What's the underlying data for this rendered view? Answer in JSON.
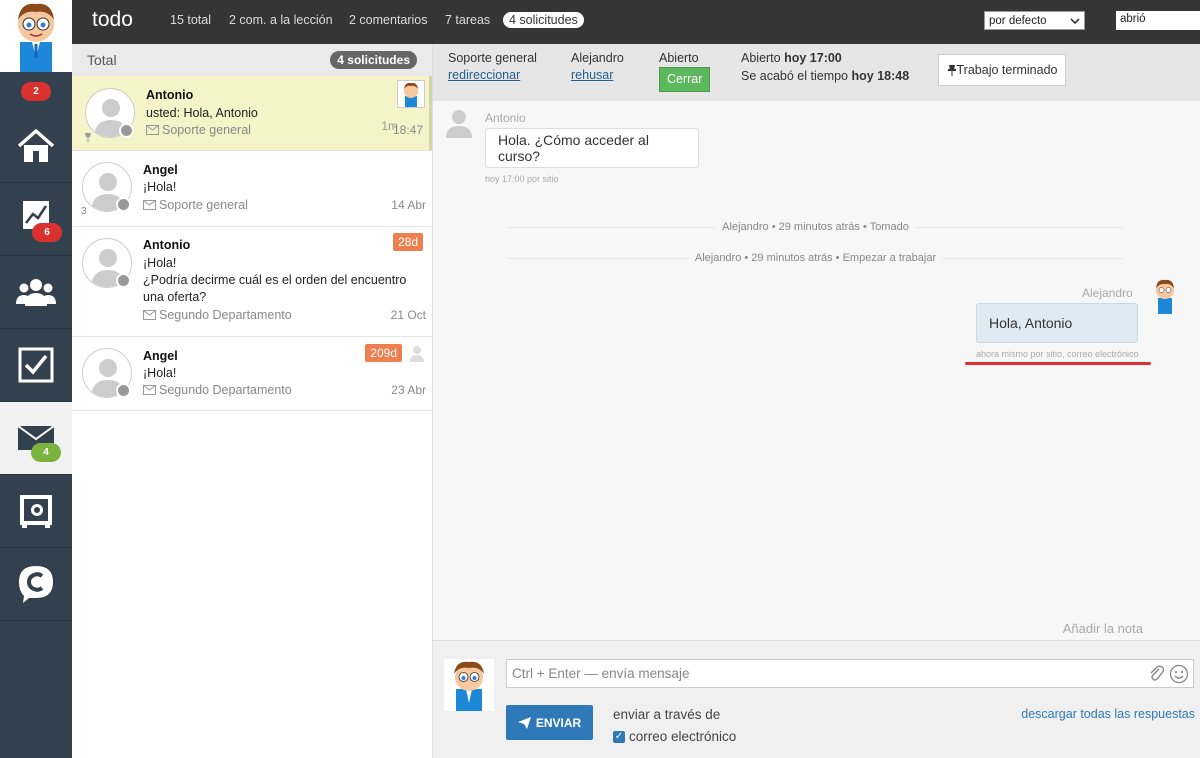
{
  "sidebar": {
    "top_badge": "2",
    "items": [
      {
        "name": "home",
        "icon": "home-icon"
      },
      {
        "name": "stats",
        "icon": "chart-icon",
        "badge": "6"
      },
      {
        "name": "users",
        "icon": "users-icon"
      },
      {
        "name": "tasks",
        "icon": "checkbox-icon"
      },
      {
        "name": "mail",
        "icon": "mail-icon",
        "badge": "4"
      },
      {
        "name": "vault",
        "icon": "safe-icon"
      },
      {
        "name": "chat",
        "icon": "chat-c-icon"
      }
    ]
  },
  "topbar": {
    "title": "todo",
    "stats": [
      "15 total",
      "2 com. a la lección",
      "2 comentarios",
      "7 tareas"
    ],
    "active_pill": "4 solicitudes",
    "sort_select": "por defecto",
    "filter_value": "abrió"
  },
  "list": {
    "header": "Total",
    "header_pill": "4 solicitudes",
    "conversations": [
      {
        "name": "Antonio",
        "message": "usted: Hola, Antonio",
        "dept": "Soporte general",
        "time": "18:47",
        "age": "1m"
      },
      {
        "name": "Angel",
        "message": "¡Hola!",
        "dept": "Soporte general",
        "time": "14 Abr",
        "count": "3"
      },
      {
        "name": "Antonio",
        "message1": "¡Hola!",
        "message2": "¿Podría decirme cuál es el orden del encuentro una oferta?",
        "dept": "Segundo Departamento",
        "time": "21 Oct",
        "age": "28d"
      },
      {
        "name": "Angel",
        "message": "¡Hola!",
        "dept": "Segundo Departamento",
        "time": "23 Abr",
        "age": "209d"
      }
    ]
  },
  "detail": {
    "info": {
      "dept_label": "Soporte general",
      "dept_link": "redireccionar",
      "agent_label": "Alejandro",
      "agent_link": "rehusar",
      "status_label": "Abierto",
      "close_button": "Cerrar",
      "opened_prefix": "Abierto",
      "opened_time": "hoy 17:00",
      "timeout_prefix": "Se acabó el tiempo",
      "timeout_time": "hoy 18:48",
      "done_button": "Trabajo terminado"
    },
    "messages": {
      "in_author": "Antonio",
      "in_text": "Hola. ¿Cómo acceder al curso?",
      "in_meta": "hoy 17:00 por sitio",
      "event1": "Alejandro • 29 minutos atrás • Tomado",
      "event2": "Alejandro • 29 minutos atrás • Empezar a trabajar",
      "out_author": "Alejandro",
      "out_text": "Hola, Antonio",
      "out_meta": "ahora mismo por sitio, correo electrónico"
    },
    "add_note": "Añadir la nota",
    "composer": {
      "placeholder": "Ctrl + Enter — envía mensaje",
      "send_button": "ENVIAR",
      "via_label": "enviar a través de",
      "via_channel": "correo electrónico",
      "download_link": "descargar todas las respuestas"
    }
  }
}
